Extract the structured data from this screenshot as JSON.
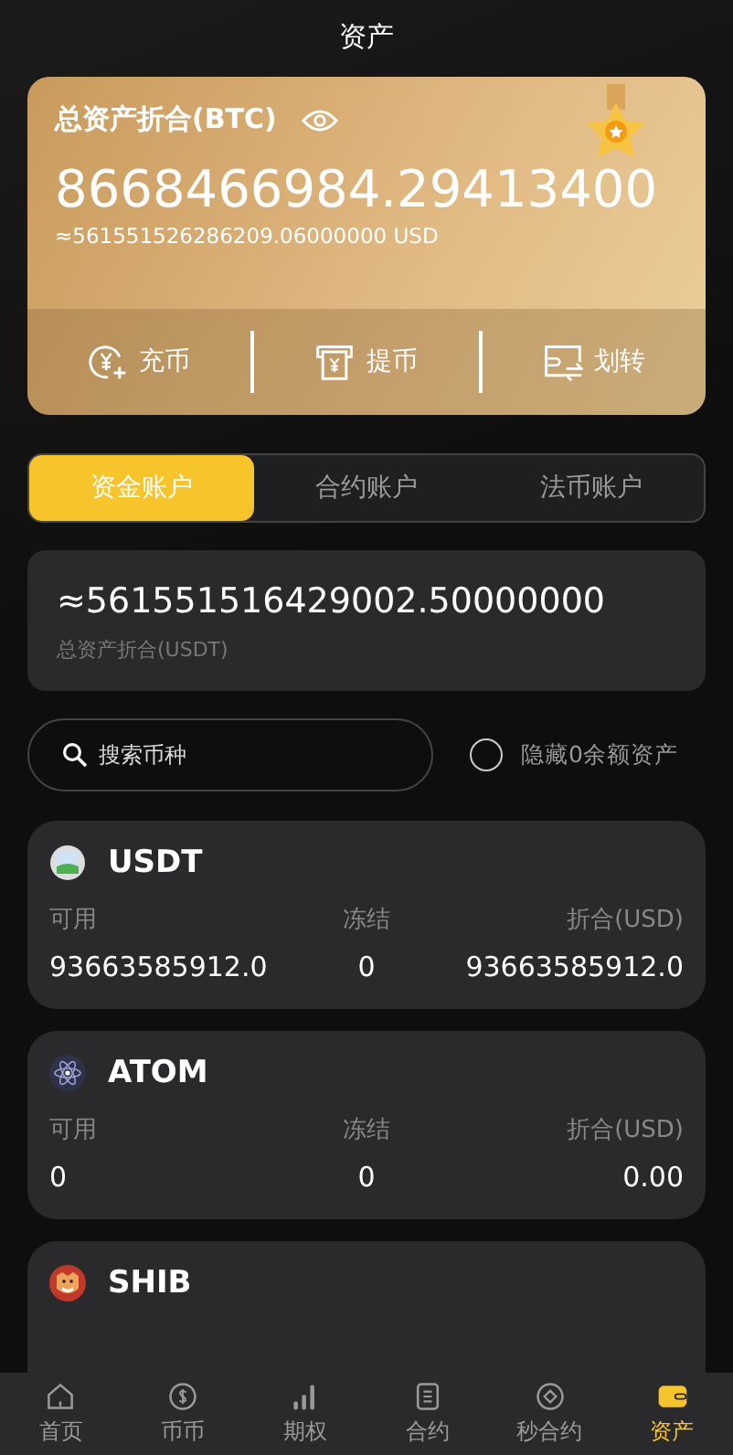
{
  "header": {
    "title": "资产"
  },
  "summary_card": {
    "label": "总资产折合(BTC)",
    "balance": "8668466984.29413400",
    "usd_equivalent": "≈561551526286209.06000000 USD",
    "actions": [
      "充币",
      "提币",
      "划转"
    ]
  },
  "account_tabs": [
    {
      "label": "资金账户",
      "selected": true
    },
    {
      "label": "合约账户",
      "selected": false
    },
    {
      "label": "法币账户",
      "selected": false
    }
  ],
  "total": {
    "value": "≈561551516429002.50000000",
    "caption": "总资产折合(USDT)"
  },
  "search": {
    "placeholder": "搜索币种"
  },
  "hide_zero": {
    "label": "隐藏0余额资产",
    "checked": false
  },
  "coins": [
    {
      "name": "USDT",
      "columns": [
        "可用",
        "冻结",
        "折合(USD)"
      ],
      "values": [
        "93663585912.0",
        "0",
        "93663585912.0"
      ]
    },
    {
      "name": "ATOM",
      "columns": [
        "可用",
        "冻结",
        "折合(USD)"
      ],
      "values": [
        "0",
        "0",
        "0.00"
      ]
    },
    {
      "name": "SHIB"
    }
  ],
  "nav": [
    {
      "label": "首页",
      "selected": false
    },
    {
      "label": "币币",
      "selected": false
    },
    {
      "label": "期权",
      "selected": false
    },
    {
      "label": "合约",
      "selected": false
    },
    {
      "label": "秒合约",
      "selected": false
    },
    {
      "label": "资产",
      "selected": true
    }
  ]
}
